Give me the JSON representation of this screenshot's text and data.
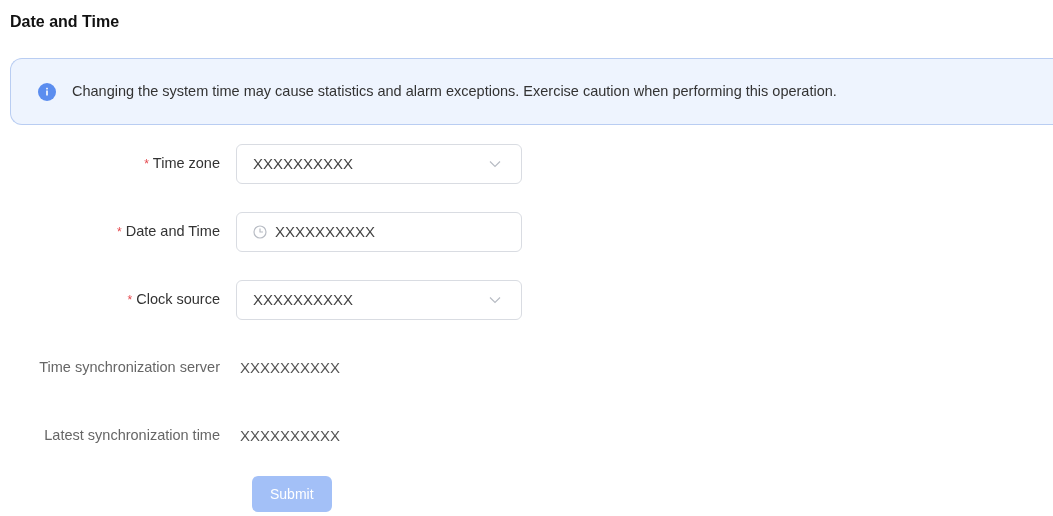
{
  "title": "Date and Time",
  "alert": {
    "text": "Changing the system time may cause statistics and alarm exceptions. Exercise caution when performing this operation."
  },
  "fields": [
    {
      "kind": "select",
      "required_mark": "*",
      "label": "Time zone",
      "value": "XXXXXXXXXX"
    },
    {
      "kind": "datetime",
      "required_mark": "*",
      "label": "Date and Time",
      "value": "XXXXXXXXXX"
    },
    {
      "kind": "select",
      "required_mark": "*",
      "label": "Clock source",
      "value": "XXXXXXXXXX"
    },
    {
      "kind": "text",
      "label": "Time synchronization server",
      "value": "XXXXXXXXXX"
    },
    {
      "kind": "text",
      "label": "Latest synchronization time",
      "value": "XXXXXXXXXX"
    }
  ],
  "submit": {
    "label": "Submit",
    "disabled": true
  }
}
